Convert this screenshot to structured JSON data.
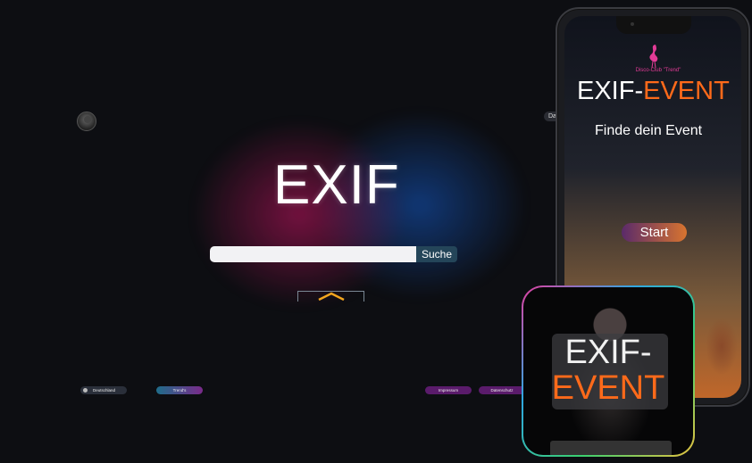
{
  "desktop": {
    "dash_label": "Dash",
    "title": "EXIF",
    "search": {
      "value": "",
      "placeholder": "",
      "button_label": "Suche"
    },
    "footer": {
      "language": "Deutschland",
      "trends": "Trend's",
      "imprint": "Impressum",
      "privacy": "Datenschutz"
    }
  },
  "phone": {
    "club_name": "Disco-Club \"Trend\"",
    "title_part1": "EXIF-",
    "title_part2": "EVENT",
    "subtitle": "Finde dein Event",
    "start_label": "Start"
  },
  "app_icon": {
    "line1": "EXIF-",
    "line2": "EVENT"
  },
  "colors": {
    "accent_orange": "#ff6a1a",
    "club_pink": "#e23b96",
    "search_button": "#244559",
    "background": "#0d0e12"
  }
}
